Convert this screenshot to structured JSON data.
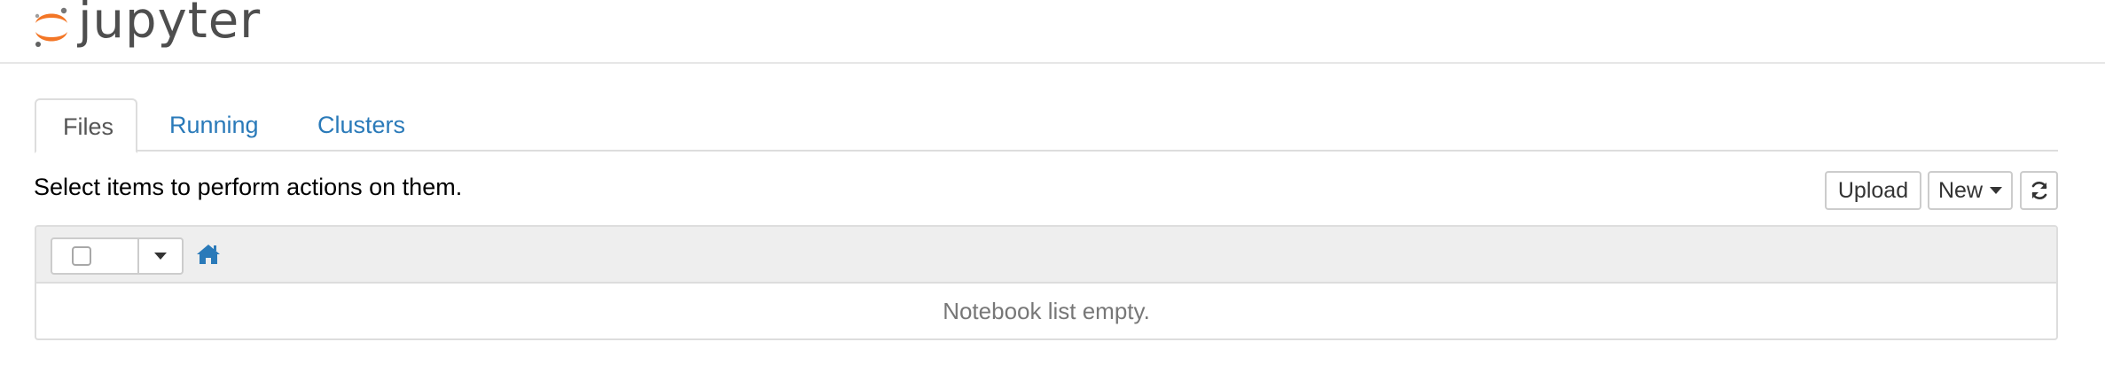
{
  "header": {
    "logo_text": "jupyter",
    "logo_icon": "jupyter-logo-icon",
    "brand_color": "#f37626"
  },
  "tabs": [
    {
      "label": "Files",
      "active": true
    },
    {
      "label": "Running",
      "active": false
    },
    {
      "label": "Clusters",
      "active": false
    }
  ],
  "toolbar": {
    "instructions": "Select items to perform actions on them.",
    "upload_label": "Upload",
    "new_label": "New",
    "refresh_icon": "refresh-icon"
  },
  "list": {
    "select_all_icon": "checkbox-icon",
    "dropdown_icon": "caret-down-icon",
    "home_icon": "home-icon",
    "empty_message": "Notebook list empty."
  },
  "colors": {
    "link": "#2a7ab9",
    "list_header_bg": "#eeeeee",
    "border": "#dddddd",
    "muted_text": "#777777"
  }
}
